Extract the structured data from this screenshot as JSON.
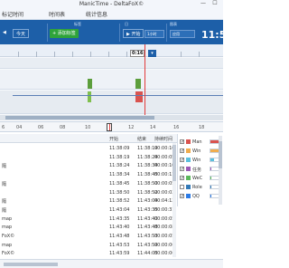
{
  "window": {
    "title": "ManicTime - DeltaFoX©",
    "minimize": "—",
    "maximize": "☐"
  },
  "menu": {
    "items": [
      "标记时间",
      "时间表",
      "统计信息"
    ]
  },
  "toolbar": {
    "group_tags": "标签",
    "group_day": "日",
    "group_zoom": "缩放",
    "group_app": "图表",
    "nav_back": "◀",
    "nav_today": "今天",
    "add_tag": "添加标签",
    "day_btn": "开始",
    "zoom_option": "1小时",
    "app_option": "应用",
    "current_time": "11:5"
  },
  "timeline": {
    "cursor_label": "0:16",
    "dropdown": "▾",
    "blocks": [
      {
        "band": "apps",
        "start_min": 0,
        "colors": []
      }
    ]
  },
  "mini_ruler": {
    "labels": [
      "6",
      "04",
      "06",
      "08",
      "10",
      "12",
      "14",
      "16",
      "18"
    ]
  },
  "table": {
    "columns": [
      "开始",
      "结束",
      "持续时间"
    ],
    "rows": [
      {
        "name": "",
        "start": "11:38:09",
        "end": "11:38:19",
        "duration": "00:00:10"
      },
      {
        "name": "",
        "start": "11:38:19",
        "end": "11:38:24",
        "duration": "00:00:05"
      },
      {
        "name": "隔",
        "start": "11:38:24",
        "end": "11:38:34",
        "duration": "00:00:10"
      },
      {
        "name": "",
        "start": "11:38:34",
        "end": "11:38:45",
        "duration": "00:00:11"
      },
      {
        "name": "隔",
        "start": "11:38:45",
        "end": "11:38:50",
        "duration": "00:00:05"
      },
      {
        "name": "",
        "start": "11:38:50",
        "end": "11:38:52",
        "duration": "00:00:02"
      },
      {
        "name": "隔",
        "start": "11:38:52",
        "end": "11:43:04",
        "duration": "00:04:12"
      },
      {
        "name": "隔",
        "start": "11:43:04",
        "end": "11:43:35",
        "duration": "00:00:31"
      },
      {
        "name": "map",
        "start": "11:43:35",
        "end": "11:43:40",
        "duration": "00:00:05"
      },
      {
        "name": "map",
        "start": "11:43:40",
        "end": "11:43:48",
        "duration": "00:00:08"
      },
      {
        "name": "FoX©",
        "start": "11:43:48",
        "end": "11:43:53",
        "duration": "00:00:05"
      },
      {
        "name": "map",
        "start": "11:43:53",
        "end": "11:43:59",
        "duration": "00:00:06"
      },
      {
        "name": "FoX©",
        "start": "11:43:59",
        "end": "11:44:05",
        "duration": "00:00:06"
      }
    ]
  },
  "legend": {
    "items": [
      {
        "checked": true,
        "name": "Man",
        "percent": "",
        "color": "#d9534f",
        "fill": 0.95
      },
      {
        "checked": true,
        "name": "Win",
        "percent": "",
        "color": "#f0ad4e",
        "fill": 0.9
      },
      {
        "checked": true,
        "name": "Win",
        "percent": "",
        "color": "#5bc0de",
        "fill": 0.3
      },
      {
        "checked": true,
        "name": "任务",
        "percent": "",
        "color": "#9b59b6",
        "fill": 0.12
      },
      {
        "checked": true,
        "name": "WeC",
        "percent": "",
        "color": "#5cb85c",
        "fill": 0.1
      },
      {
        "checked": false,
        "name": "Role",
        "percent": "",
        "color": "#337ab7",
        "fill": 0.08
      },
      {
        "checked": true,
        "name": "QQ",
        "percent": "",
        "color": "#2c7be5",
        "fill": 0.05
      }
    ]
  }
}
